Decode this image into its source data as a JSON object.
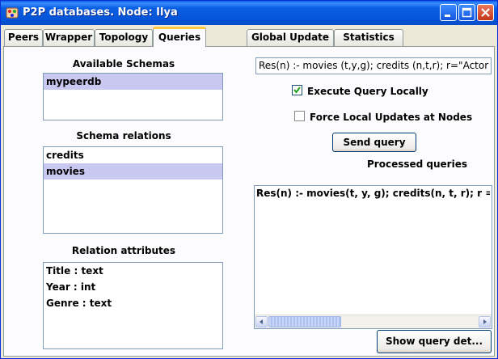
{
  "window": {
    "title": "P2P databases. Node: Ilya",
    "title_bar_color": "#0a5fe3"
  },
  "tabs": [
    {
      "label": "Peers",
      "active": false
    },
    {
      "label": "Wrapper",
      "active": false
    },
    {
      "label": "Topology",
      "active": false
    },
    {
      "label": "Queries",
      "active": true
    },
    {
      "label": "Global Update",
      "active": false
    },
    {
      "label": "Statistics",
      "active": false
    }
  ],
  "schemas": {
    "label": "Available Schemas",
    "items": [
      {
        "label": "mypeerdb",
        "selected": true
      }
    ]
  },
  "relations": {
    "label": "Schema relations",
    "items": [
      {
        "label": "credits",
        "selected": false
      },
      {
        "label": "movies",
        "selected": true
      }
    ]
  },
  "attributes": {
    "label": "Relation attributes",
    "items": [
      {
        "label": "Title : text"
      },
      {
        "label": "Year : int"
      },
      {
        "label": "Genre : text"
      }
    ]
  },
  "query": {
    "value": "Res(n) :- movies (t,y,g); credits (n,t,r); r=\"Actor"
  },
  "options": {
    "execute_locally": {
      "label": "Execute Query Locally",
      "checked": true
    },
    "force_updates": {
      "label": "Force Local Updates at Nodes",
      "checked": false
    }
  },
  "send_button": {
    "label": "Send query"
  },
  "processed": {
    "label": "Processed queries",
    "items": [
      "Res(n) :- movies(t, y, g); credits(n, t, r); r = \"Actor"
    ]
  },
  "details_button": {
    "label": "Show query det..."
  },
  "selection_color": "#c8c8f0",
  "active_tab_accent": "#ffc83c"
}
